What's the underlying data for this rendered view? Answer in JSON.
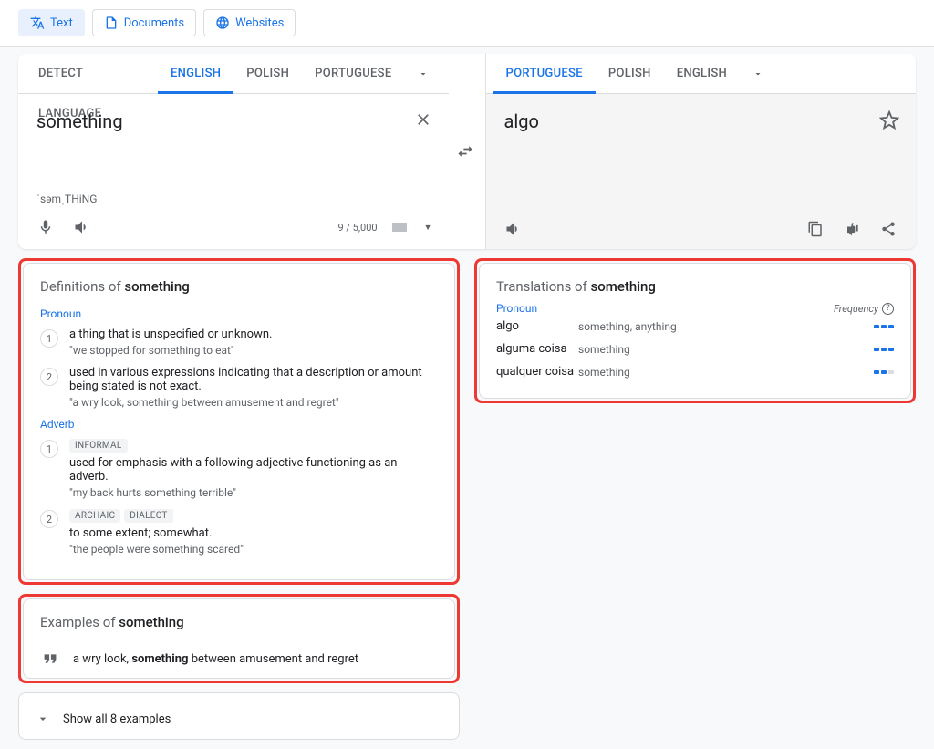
{
  "topTabs": {
    "text": "Text",
    "documents": "Documents",
    "websites": "Websites"
  },
  "sourceLang": {
    "detect": "DETECT LANGUAGE",
    "l1": "ENGLISH",
    "l2": "POLISH",
    "l3": "PORTUGUESE"
  },
  "targetLang": {
    "l1": "PORTUGUESE",
    "l2": "POLISH",
    "l3": "ENGLISH"
  },
  "source": {
    "text": "something",
    "pronunciation": "ˈsəmˌTHiNG",
    "charCount": "9 / 5,000"
  },
  "target": {
    "text": "algo"
  },
  "definitions": {
    "titlePrefix": "Definitions of ",
    "titleWord": "something",
    "groups": [
      {
        "pos": "Pronoun",
        "items": [
          {
            "num": "1",
            "tags": [],
            "text": "a thing that is unspecified or unknown.",
            "example": "\"we stopped for something to eat\""
          },
          {
            "num": "2",
            "tags": [],
            "text": "used in various expressions indicating that a description or amount being stated is not exact.",
            "example": "\"a wry look, something between amusement and regret\""
          }
        ]
      },
      {
        "pos": "Adverb",
        "items": [
          {
            "num": "1",
            "tags": [
              "INFORMAL"
            ],
            "text": "used for emphasis with a following adjective functioning as an adverb.",
            "example": "\"my back hurts something terrible\""
          },
          {
            "num": "2",
            "tags": [
              "ARCHAIC",
              "DIALECT"
            ],
            "text": "to some extent; somewhat.",
            "example": "\"the people were something scared\""
          }
        ]
      }
    ]
  },
  "examples": {
    "titlePrefix": "Examples of ",
    "titleWord": "something",
    "item1_pre": "a wry look, ",
    "item1_bold": "something",
    "item1_post": " between amusement and regret",
    "showAll": "Show all 8 examples"
  },
  "translations": {
    "titlePrefix": "Translations of ",
    "titleWord": "something",
    "freqLabel": "Frequency",
    "pos": "Pronoun",
    "rows": [
      {
        "word": "algo",
        "meaning": "something, anything",
        "freq": 3
      },
      {
        "word": "alguma coisa",
        "meaning": "something",
        "freq": 3
      },
      {
        "word": "qualquer coisa",
        "meaning": "something",
        "freq": 2
      }
    ]
  }
}
